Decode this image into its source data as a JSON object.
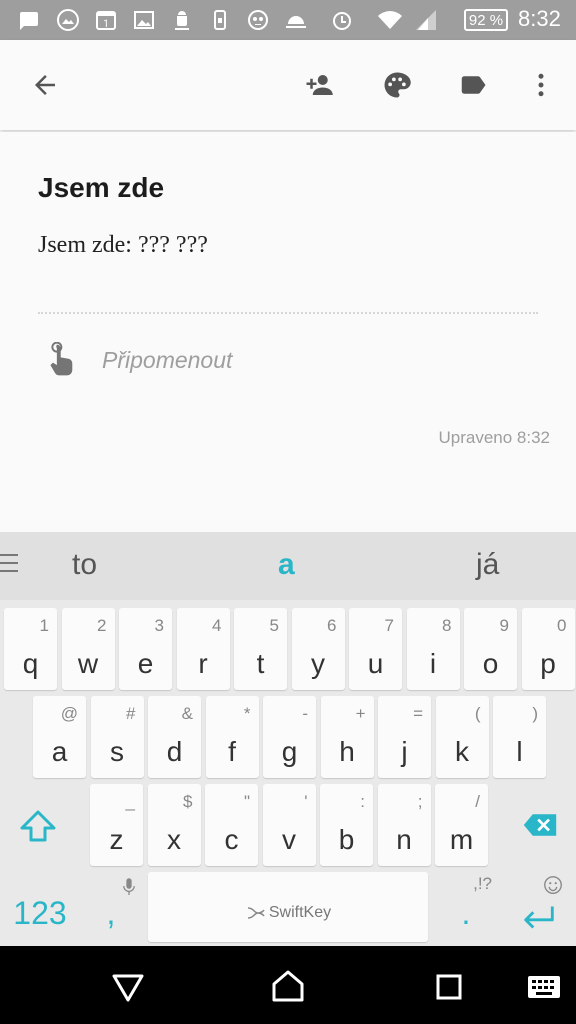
{
  "status_bar": {
    "battery_percent": "92 %",
    "time": "8:32",
    "icons": [
      "message-icon",
      "gallery-icon",
      "calendar-icon",
      "image-icon",
      "android-debug-icon",
      "device-icon",
      "alien-icon",
      "weather-icon",
      "alarm-icon",
      "wifi-icon",
      "signal-icon",
      "battery-icon"
    ]
  },
  "toolbar": {
    "icons": [
      "back-arrow-icon",
      "add-collaborator-icon",
      "palette-icon",
      "label-icon",
      "more-vert-icon"
    ]
  },
  "note": {
    "title": "Jsem zde",
    "body": "Jsem zde: ??? ???",
    "reminder_placeholder": "Připomenout",
    "edited": "Upraveno 8:32"
  },
  "keyboard": {
    "suggestions": [
      "to",
      "a",
      "já"
    ],
    "row1": [
      {
        "key": "q",
        "hint": "1"
      },
      {
        "key": "w",
        "hint": "2"
      },
      {
        "key": "e",
        "hint": "3"
      },
      {
        "key": "r",
        "hint": "4"
      },
      {
        "key": "t",
        "hint": "5"
      },
      {
        "key": "y",
        "hint": "6"
      },
      {
        "key": "u",
        "hint": "7"
      },
      {
        "key": "i",
        "hint": "8"
      },
      {
        "key": "o",
        "hint": "9"
      },
      {
        "key": "p",
        "hint": "0"
      }
    ],
    "row2": [
      {
        "key": "a",
        "hint": "@"
      },
      {
        "key": "s",
        "hint": "#"
      },
      {
        "key": "d",
        "hint": "&"
      },
      {
        "key": "f",
        "hint": "*"
      },
      {
        "key": "g",
        "hint": "-"
      },
      {
        "key": "h",
        "hint": "+"
      },
      {
        "key": "j",
        "hint": "="
      },
      {
        "key": "k",
        "hint": "("
      },
      {
        "key": "l",
        "hint": ")"
      }
    ],
    "row3": [
      {
        "key": "z",
        "hint": "_"
      },
      {
        "key": "x",
        "hint": "$"
      },
      {
        "key": "c",
        "hint": "\""
      },
      {
        "key": "v",
        "hint": "'"
      },
      {
        "key": "b",
        "hint": ":"
      },
      {
        "key": "n",
        "hint": ";"
      },
      {
        "key": "m",
        "hint": "/"
      }
    ],
    "numbers_label": "123",
    "comma": ",",
    "period": ".",
    "punct_hint": ",!?",
    "space_brand": "SwiftKey",
    "accent_color": "#29b6c8"
  },
  "nav_bar": {
    "icons": [
      "back-triangle-icon",
      "home-icon",
      "recents-icon",
      "keyboard-switch-icon"
    ]
  }
}
